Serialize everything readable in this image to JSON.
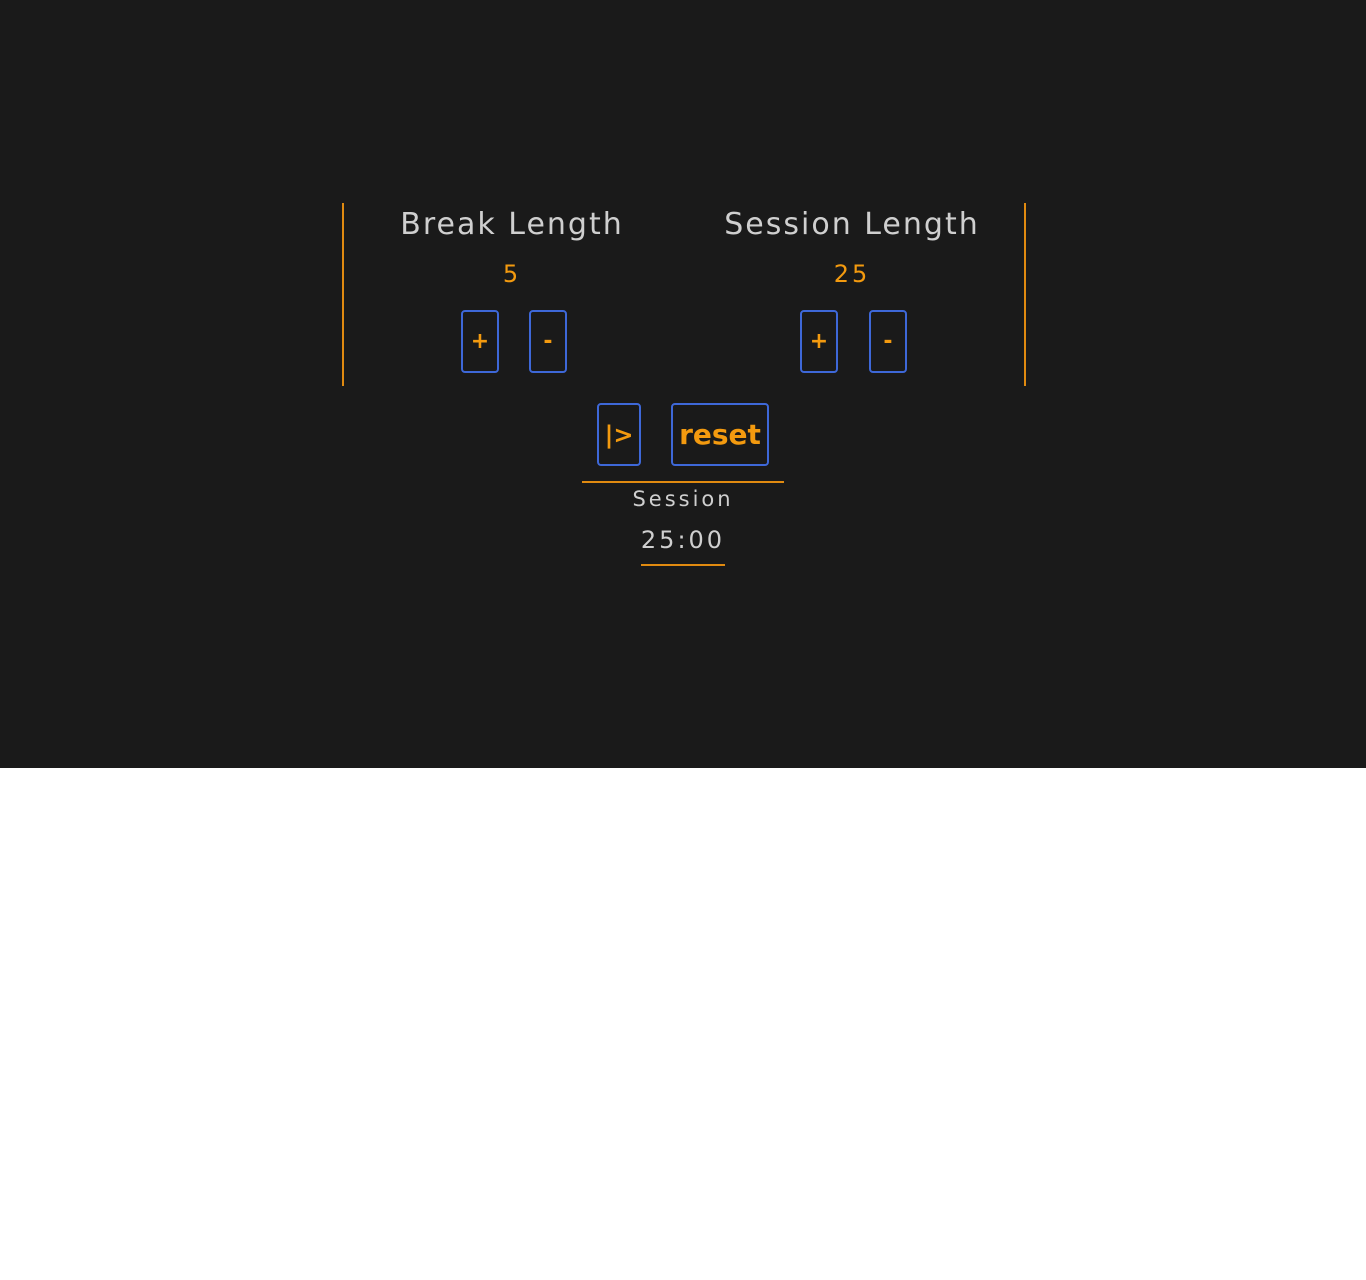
{
  "break": {
    "title": "Break Length",
    "value": "5",
    "increment_label": "+",
    "decrement_label": "-"
  },
  "session": {
    "title": "Session Length",
    "value": "25",
    "increment_label": "+",
    "decrement_label": "-"
  },
  "controls": {
    "play_label": "|>",
    "reset_label": "reset"
  },
  "timer": {
    "label": "Session",
    "time": "25:00"
  },
  "colors": {
    "background": "#1a1a1a",
    "accent": "#f39a0f",
    "border_accent": "#e08a10",
    "button_border": "#3e68d8",
    "text": "#cfcfcf"
  }
}
